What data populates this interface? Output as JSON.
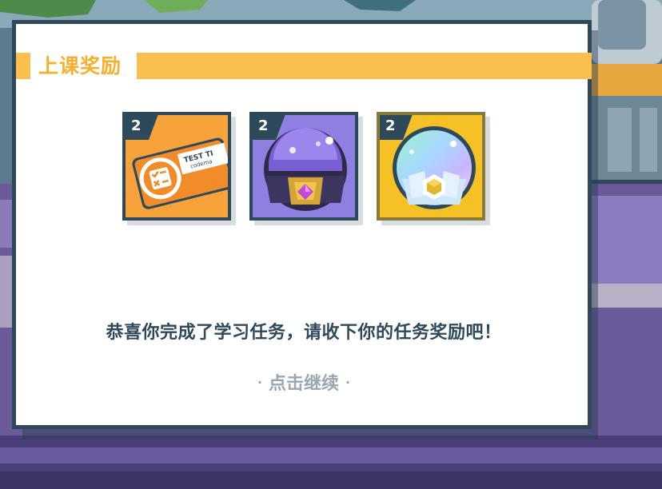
{
  "modal": {
    "title": "上课奖励",
    "message": "恭喜你完成了学习任务，请收下你的任务奖励吧！",
    "continue_label": "点击继续",
    "continue_dot": "·"
  },
  "rewards": [
    {
      "name": "test-ticket-card",
      "count": "2",
      "card_text": "TEST TI",
      "card_subtext": "codema",
      "color": "#f7a23a"
    },
    {
      "name": "purple-gem-orb",
      "count": "2",
      "color": "#8f7fe0"
    },
    {
      "name": "rainbow-gem-orb",
      "count": "2",
      "color": "#f6c027"
    }
  ],
  "colors": {
    "accent": "#fbbf50",
    "border": "#2e4a5a",
    "text": "#2e4a5a",
    "muted": "#9aa7b0"
  }
}
